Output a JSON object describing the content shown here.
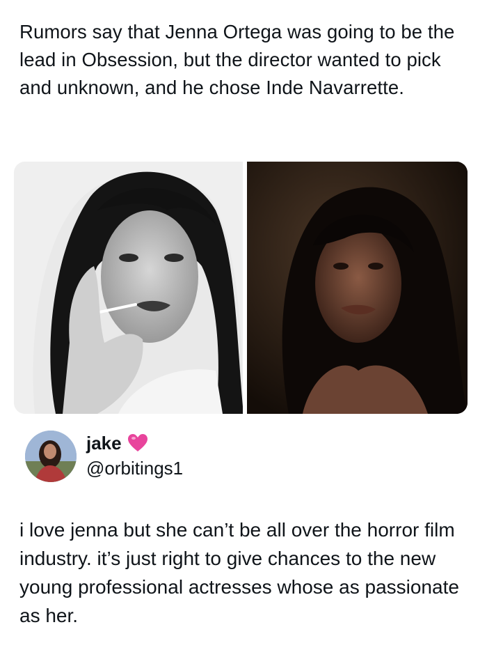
{
  "post": {
    "text": "Rumors say that Jenna Ortega was going to be the lead in Obsession, but the director wanted to pick and unknown, and he chose Inde Navarrette."
  },
  "media": {
    "images": [
      {
        "icon": "bw-portrait-photo"
      },
      {
        "icon": "dark-film-still-photo"
      }
    ]
  },
  "reply": {
    "author": {
      "name": "jake",
      "badge_icon": "pink-heart-icon",
      "handle": "@orbitings1"
    },
    "text": "i love jenna but she can’t be all over the horror film industry. it’s just right to give chances to the new young professional actresses whose as passionate as her."
  },
  "colors": {
    "text": "#0f1419",
    "heart": "#e8449c",
    "background": "#ffffff"
  }
}
